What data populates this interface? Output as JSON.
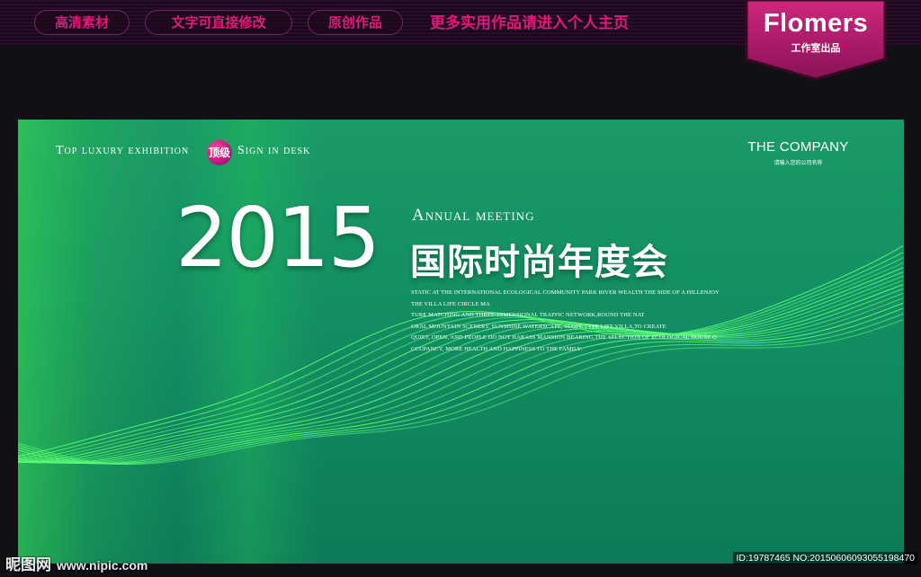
{
  "header": {
    "pills": [
      "高清素材",
      "文字可直接修改",
      "原创作品"
    ],
    "promo": "更多实用作品请进入个人主页",
    "logo": {
      "name": "Flomers",
      "sub": "工作室出品"
    }
  },
  "banner": {
    "tag_left": "Top luxury exhibition",
    "badge": "顶级",
    "tag_right": "Sign in desk",
    "company": "THE COMPANY",
    "company_sub": "请输入您的公司名称",
    "year": "2015",
    "annual": "Annual meeting",
    "title_cn": "国际时尚年度会",
    "description": [
      "STATIC AT THE INTERNATIONAL ECOLOGICAL COMMUNITY PARK RIVER WEALTH THE SIDE OF A HILLENJOY",
      "THE VILLA LIFE CIRCLE MA",
      "TURE MATCHING AND THREE-DIMENSIONAL TRAFFIC NETWORK,ROUND THE NAT",
      "URAL MOUNTAIN SCENERY, SUNSHINE WATERSCAPE, SLOPE TYPE LIFT VILLA,TO CREATE",
      "QUIET, OPEN, AND PEOPLE DO NOT HARASS MANSION BEARING,THE SELECTION OF ECOLOGICAL HOUSE O",
      "CCUPANCY, MORE HEALTH AND HAPPINESS TO THE FAMILY."
    ]
  },
  "footer": {
    "watermark_cn": "昵图网",
    "watermark_url": "www.nipic.com",
    "id_line": "ID:19787465 NO:20150606093055198470"
  },
  "colors": {
    "accent_magenta": "#e0197a",
    "banner_green": "#139063",
    "wave_green": "#5cff7a"
  }
}
